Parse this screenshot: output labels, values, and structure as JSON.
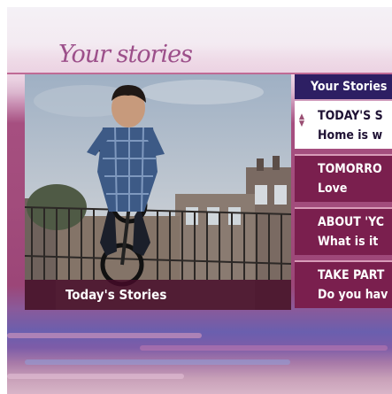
{
  "header": {
    "logo_text": "Your stories"
  },
  "video": {
    "caption": "Today's Stories"
  },
  "menu": {
    "header": "Your Stories",
    "items": [
      {
        "line1": "TODAY'S S",
        "line2": "Home is w",
        "selected": true
      },
      {
        "line1": "TOMORRO",
        "line2": "Love",
        "selected": false
      },
      {
        "line1": "ABOUT 'YC",
        "line2": "What is it",
        "selected": false
      },
      {
        "line1": "TAKE PART",
        "line2": "Do you hav",
        "selected": false
      }
    ]
  },
  "colors": {
    "logo": "#9c4f8a",
    "menu_header_bg": "#2d1f63",
    "menu_item_bg": "#7a1f4e",
    "menu_selected_bg": "#ffffff",
    "caption_bg": "#46102a"
  },
  "icons": {
    "scroll": "up-down-arrow-icon"
  }
}
